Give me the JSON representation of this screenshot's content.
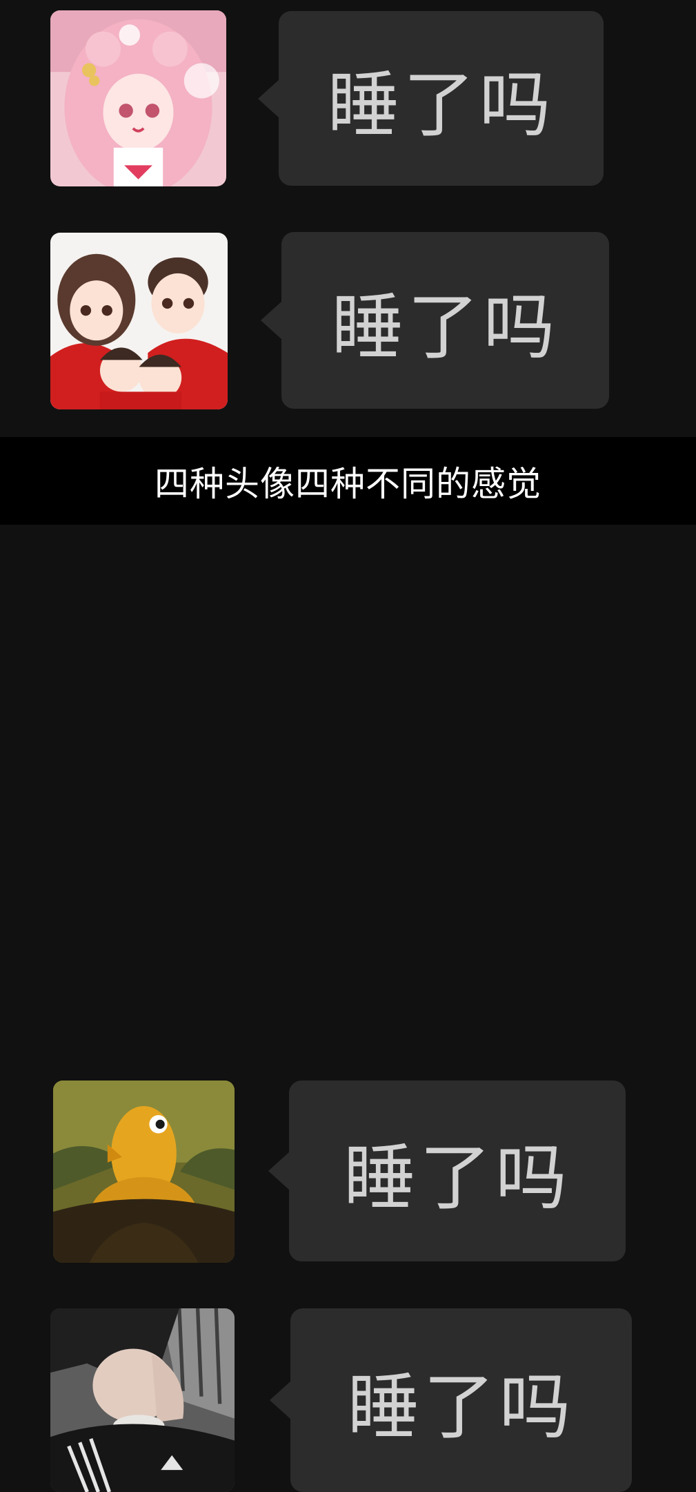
{
  "caption": "四种头像四种不同的感觉",
  "messages": [
    {
      "avatar": "anime-princess-avatar",
      "text": "睡了吗"
    },
    {
      "avatar": "cartoon-family-avatar",
      "text": "睡了吗"
    },
    {
      "avatar": "duck-mona-lisa-avatar",
      "text": "睡了吗"
    },
    {
      "avatar": "boy-selfie-avatar",
      "text": "睡了吗"
    }
  ],
  "colors": {
    "background": "#111111",
    "banner": "#000000",
    "bubble": "#2c2c2c",
    "message_text": "#d2d2d2",
    "caption_text": "#ffffff"
  }
}
